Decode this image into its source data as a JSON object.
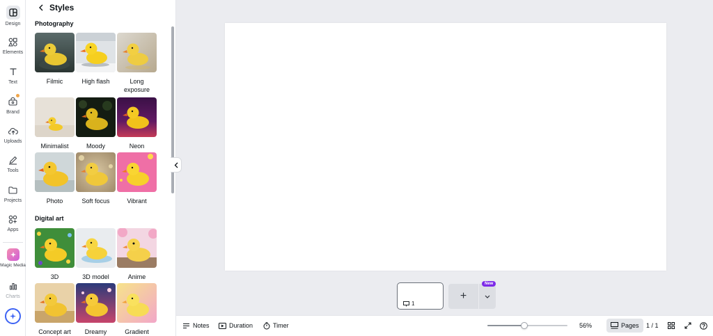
{
  "rail": {
    "items": [
      {
        "label": "Design",
        "icon": "design-icon"
      },
      {
        "label": "Elements",
        "icon": "elements-icon"
      },
      {
        "label": "Text",
        "icon": "text-icon"
      },
      {
        "label": "Brand",
        "icon": "brand-icon"
      },
      {
        "label": "Uploads",
        "icon": "uploads-icon"
      },
      {
        "label": "Tools",
        "icon": "tools-icon"
      },
      {
        "label": "Projects",
        "icon": "projects-icon"
      },
      {
        "label": "Apps",
        "icon": "apps-icon"
      },
      {
        "label": "Magic Media",
        "icon": "magic-media-icon"
      },
      {
        "label": "Charts",
        "icon": "charts-icon"
      }
    ]
  },
  "panel": {
    "title": "Styles",
    "sections": [
      {
        "title": "Photography",
        "styles": [
          "Filmic",
          "High flash",
          "Long exposure",
          "Minimalist",
          "Moody",
          "Neon",
          "Photo",
          "Soft focus",
          "Vibrant"
        ]
      },
      {
        "title": "Digital art",
        "styles": [
          "3D",
          "3D model",
          "Anime",
          "Concept art",
          "Dreamy",
          "Gradient"
        ]
      }
    ]
  },
  "pages": {
    "current_page_num": "1",
    "new_badge": "New",
    "add_symbol": "+"
  },
  "bottom_bar": {
    "notes_label": "Notes",
    "duration_label": "Duration",
    "timer_label": "Timer",
    "zoom_value": "56%",
    "zoom_fraction": 0.46,
    "pages_label": "Pages",
    "page_counter": "1 / 1"
  },
  "colors": {
    "accent": "#3d63f4",
    "new_badge": "#7d2ae8",
    "canvas_bg": "#ebecf0"
  }
}
